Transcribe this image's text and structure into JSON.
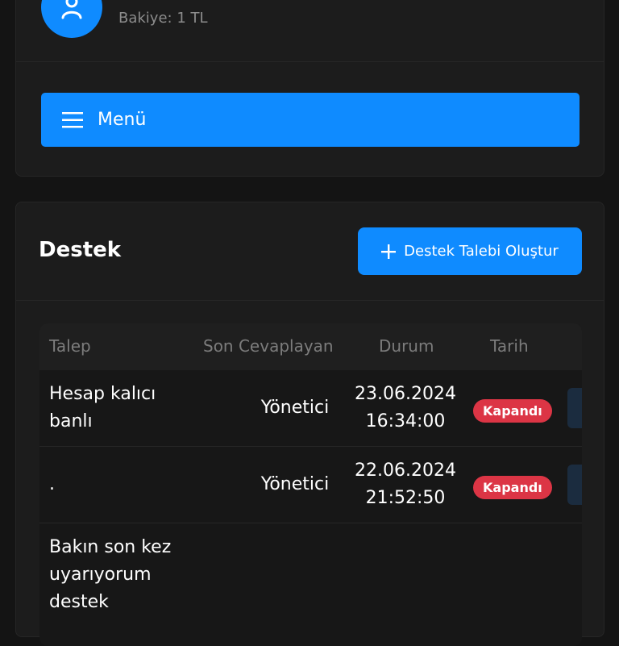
{
  "profile": {
    "balance": "Bakiye: 1 TL",
    "menu_label": "Menü"
  },
  "support": {
    "title": "Destek",
    "create_label": "Destek Talebi Oluştur",
    "columns": [
      "Talep",
      "Son Cevaplayan",
      "Durum",
      "Tarih"
    ],
    "rows": [
      {
        "talep": "Hesap kalıcı banlı",
        "son_cevaplayan": "Yönetici",
        "date": "23.06.2024 16:34:00",
        "status": "Kapandı"
      },
      {
        "talep": ".",
        "son_cevaplayan": "Yönetici",
        "date": "22.06.2024 21:52:50",
        "status": "Kapandı"
      },
      {
        "talep": "Bakın son kez uyarıyorum destek",
        "son_cevaplayan": "",
        "date": "",
        "status": ""
      }
    ]
  },
  "colors": {
    "accent": "#0f8bff",
    "status_closed": "#dc3545",
    "background": "#141414",
    "card": "#1c1c1c"
  },
  "icons": {
    "avatar": "user-icon",
    "menu": "hamburger-icon",
    "create": "plus-icon"
  }
}
